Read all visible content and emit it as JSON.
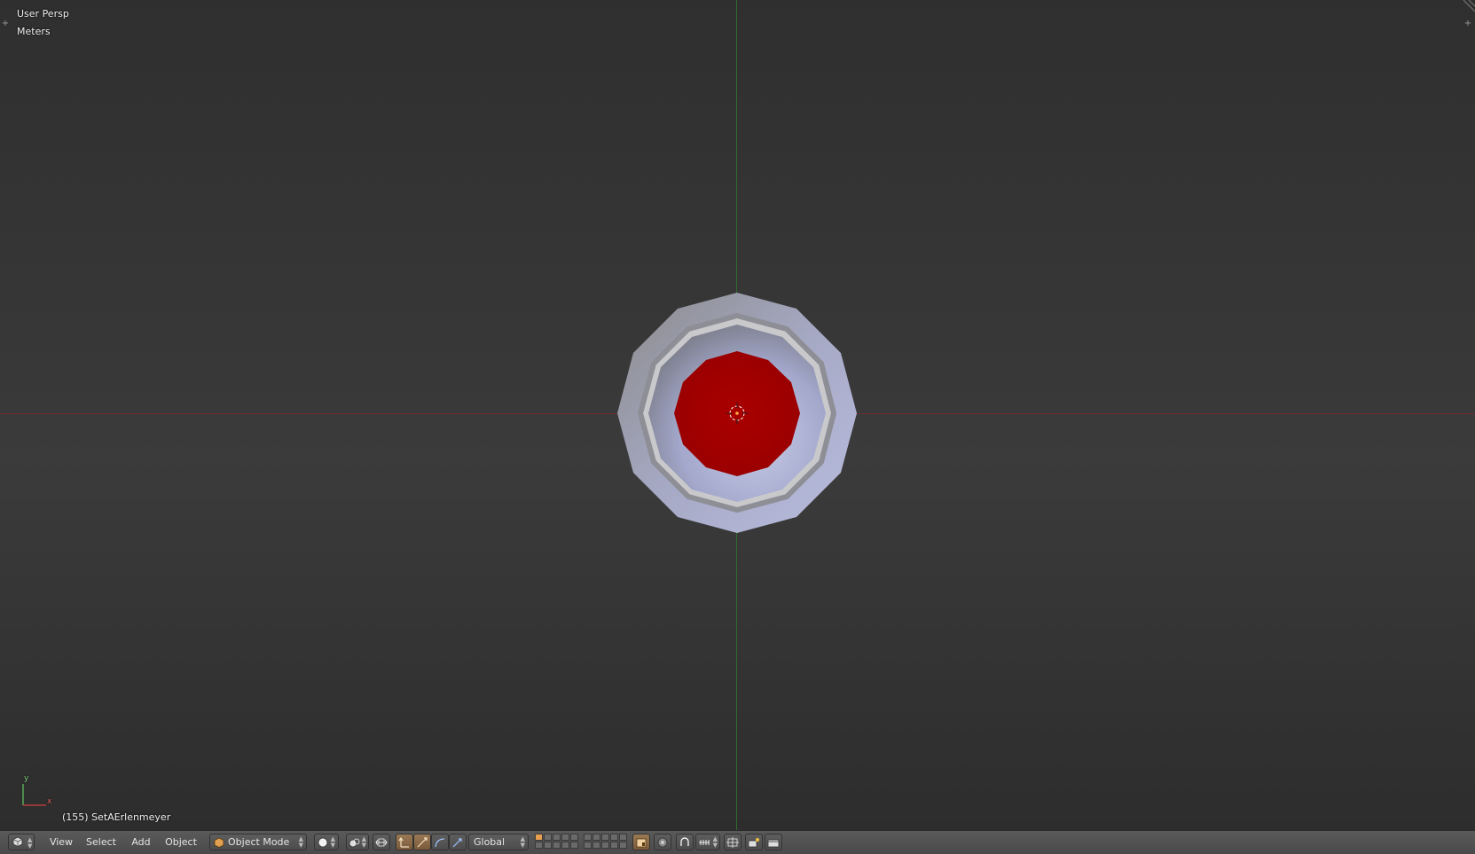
{
  "viewport": {
    "view_name": "User Persp",
    "units": "Meters",
    "object_info": "(155) SetAErlenmeyer",
    "axis_labels": {
      "x": "x",
      "y": "y"
    },
    "colors": {
      "x_axis": "#8a3030",
      "y_axis": "#3a8a3a",
      "object_red": "#a10000",
      "object_glass": "#a8acc8"
    }
  },
  "header": {
    "editor_type_icon": "3d-view-icon",
    "menus": {
      "view": "View",
      "select": "Select",
      "add": "Add",
      "object": "Object"
    },
    "mode": {
      "icon": "cube-icon",
      "label": "Object Mode"
    },
    "viewport_shading_icon": "solid-sphere-icon",
    "pivot_icon": "pivot-point-icon",
    "manipulator_icons": [
      "manipulator-toggle-icon",
      "translate-icon",
      "rotate-icon",
      "scale-icon"
    ],
    "orientation": "Global",
    "layers_icon": "layers-grid-icon",
    "lock_icon": "lock-camera-icon",
    "proportional_icon": "proportional-editing-icon",
    "snap_icons": [
      "snap-magnet-icon",
      "snap-increment-icon"
    ],
    "render_icons": [
      "opengl-render-icon",
      "opengl-animation-icon"
    ]
  }
}
